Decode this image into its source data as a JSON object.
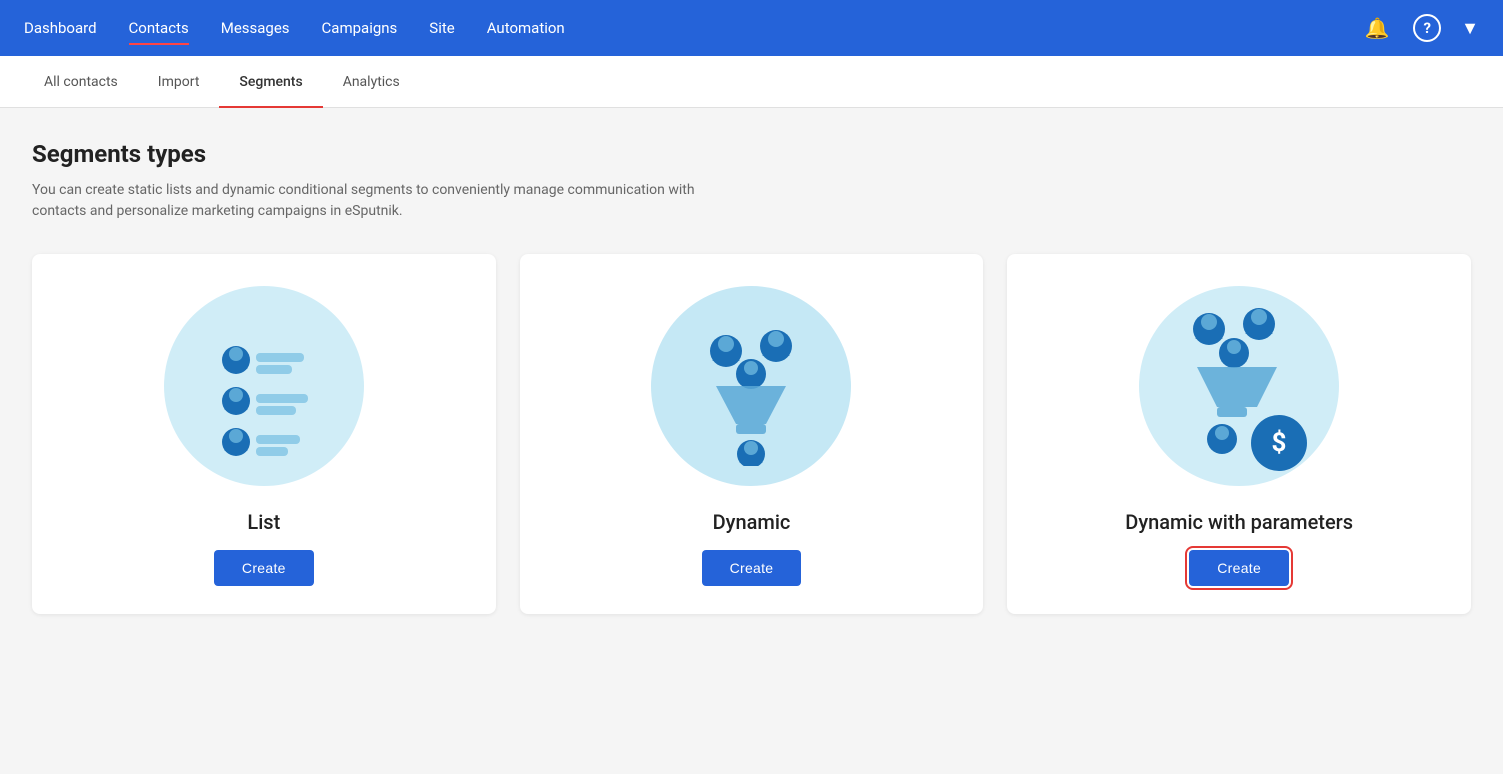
{
  "nav": {
    "items": [
      {
        "label": "Dashboard",
        "active": false
      },
      {
        "label": "Contacts",
        "active": true
      },
      {
        "label": "Messages",
        "active": false
      },
      {
        "label": "Campaigns",
        "active": false
      },
      {
        "label": "Site",
        "active": false
      },
      {
        "label": "Automation",
        "active": false
      }
    ],
    "bell_label": "🔔",
    "help_label": "?",
    "dropdown_label": "▼"
  },
  "subnav": {
    "items": [
      {
        "label": "All contacts",
        "active": false
      },
      {
        "label": "Import",
        "active": false
      },
      {
        "label": "Segments",
        "active": true
      },
      {
        "label": "Analytics",
        "active": false
      }
    ]
  },
  "page": {
    "title": "Segments types",
    "description": "You can create static lists and dynamic conditional segments to conveniently manage communication with contacts and personalize marketing campaigns in eSputnik."
  },
  "cards": [
    {
      "id": "list",
      "label": "List",
      "create_btn": "Create",
      "highlighted": false
    },
    {
      "id": "dynamic",
      "label": "Dynamic",
      "create_btn": "Create",
      "highlighted": false
    },
    {
      "id": "dynamic-params",
      "label": "Dynamic with parameters",
      "create_btn": "Create",
      "highlighted": true
    }
  ],
  "colors": {
    "brand_blue": "#2563d9",
    "accent_red": "#e53935",
    "person_dark": "#1a6eb5",
    "person_light": "#64b5e8",
    "circle_bg": "#cdeaf7",
    "funnel_color": "#5ba8d6",
    "dollar_bg": "#1a6eb5"
  }
}
